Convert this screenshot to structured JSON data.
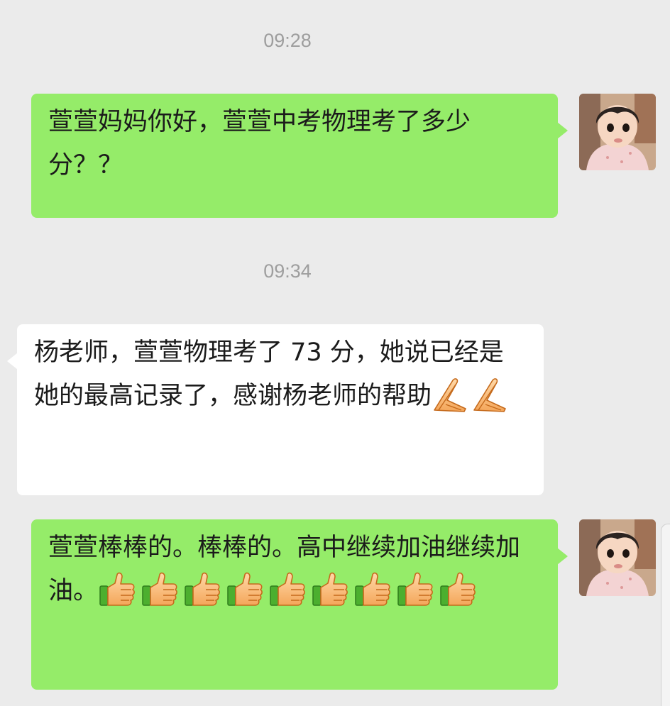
{
  "chat": {
    "timestamps": [
      "09:28",
      "09:34"
    ],
    "messages": [
      {
        "sender": "me",
        "text": "萱萱妈妈你好，萱萱中考物理考了多少分？？"
      },
      {
        "sender": "other",
        "text": "杨老师，萱萱物理考了 73 分，她说已经是她的最高记录了，感谢杨老师的帮助",
        "emoji": "folded-hands-icon",
        "emoji_count": 2
      },
      {
        "sender": "me",
        "text": "萱萱棒棒的。棒棒的。高中继续加油继续加油。",
        "emoji": "thumbs-up-icon",
        "emoji_count": 9
      }
    ]
  },
  "colors": {
    "background": "#ebebeb",
    "my_bubble": "#95ec69",
    "other_bubble": "#ffffff",
    "timestamp": "#9e9e9e",
    "text": "#1b1b1b"
  }
}
